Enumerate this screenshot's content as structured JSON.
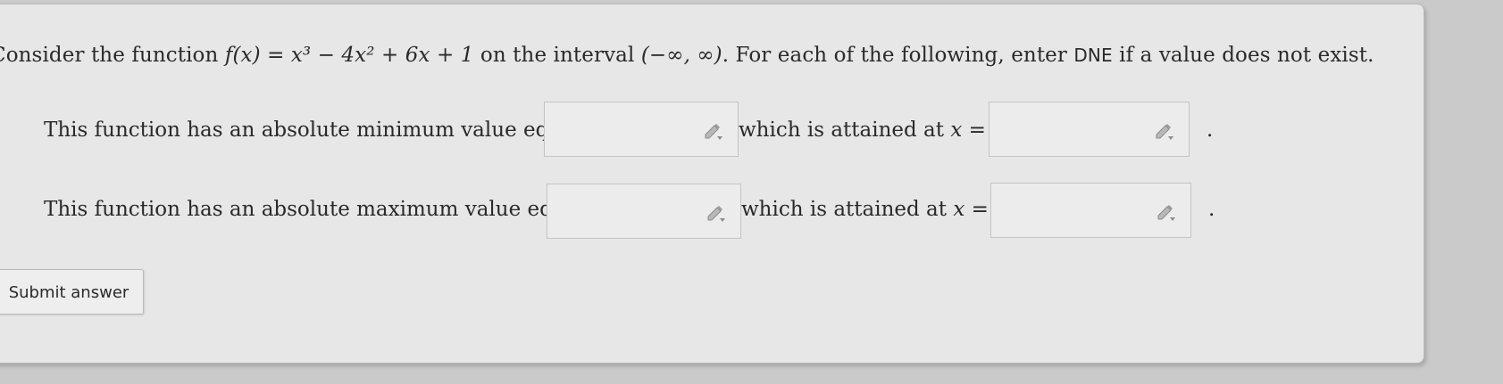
{
  "question": {
    "prefix": "Consider the function ",
    "function_expr": "f(x) = x³ − 4x² + 6x + 1",
    "middle": " on the interval ",
    "interval": "(−∞, ∞)",
    "suffix_a": ". For each of the following, enter ",
    "dne": "DNE",
    "suffix_b": " if a value does not exist."
  },
  "min_row": {
    "label": "This function has an absolute minimum value equal to",
    "attained_label": "which is attained at",
    "x_expr": "x =",
    "period": ".",
    "value_field": "",
    "x_field": ""
  },
  "max_row": {
    "label": "This function has an absolute maximum value equal to",
    "attained_label": "which is attained at",
    "x_expr": "x =",
    "period": ".",
    "value_field": "",
    "x_field": ""
  },
  "submit": {
    "label": "Submit answer"
  },
  "icons": {
    "field_icon": "pencil-dropdown-icon"
  },
  "colors": {
    "panel_bg": "#e6e7e6",
    "page_bg": "#c9cac9",
    "text": "#2a2a2a"
  }
}
